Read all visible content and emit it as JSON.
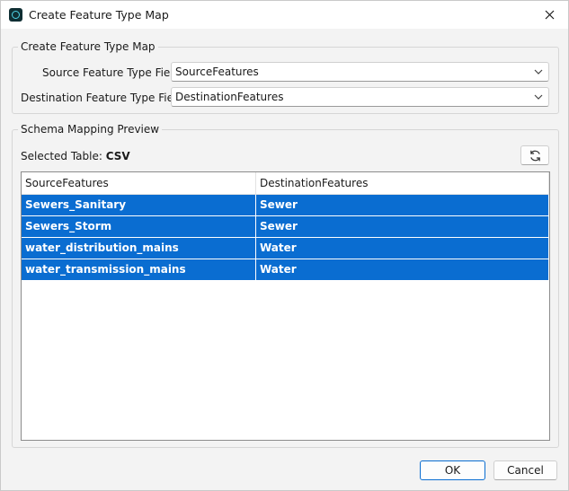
{
  "window": {
    "title": "Create Feature Type Map"
  },
  "create_group": {
    "legend": "Create Feature Type Map",
    "source_label": "Source Feature Type Field:",
    "source_value": "SourceFeatures",
    "destination_label": "Destination Feature Type Field:",
    "destination_value": "DestinationFeatures"
  },
  "preview_group": {
    "legend": "Schema Mapping Preview",
    "selected_table_prefix": "Selected Table:",
    "selected_table_value": "CSV",
    "table": {
      "headers": [
        "SourceFeatures",
        "DestinationFeatures"
      ],
      "rows": [
        [
          "Sewers_Sanitary",
          "Sewer"
        ],
        [
          "Sewers_Storm",
          "Sewer"
        ],
        [
          "water_distribution_mains",
          "Water"
        ],
        [
          "water_transmission_mains",
          "Water"
        ]
      ]
    }
  },
  "buttons": {
    "ok": "OK",
    "cancel": "Cancel"
  },
  "icons": {
    "app": "app-icon",
    "close": "close-icon",
    "dropdown": "chevron-down-icon",
    "refresh": "refresh-icon"
  },
  "colors": {
    "selection": "#0a6dd1",
    "accent": "#0a6dd1"
  }
}
